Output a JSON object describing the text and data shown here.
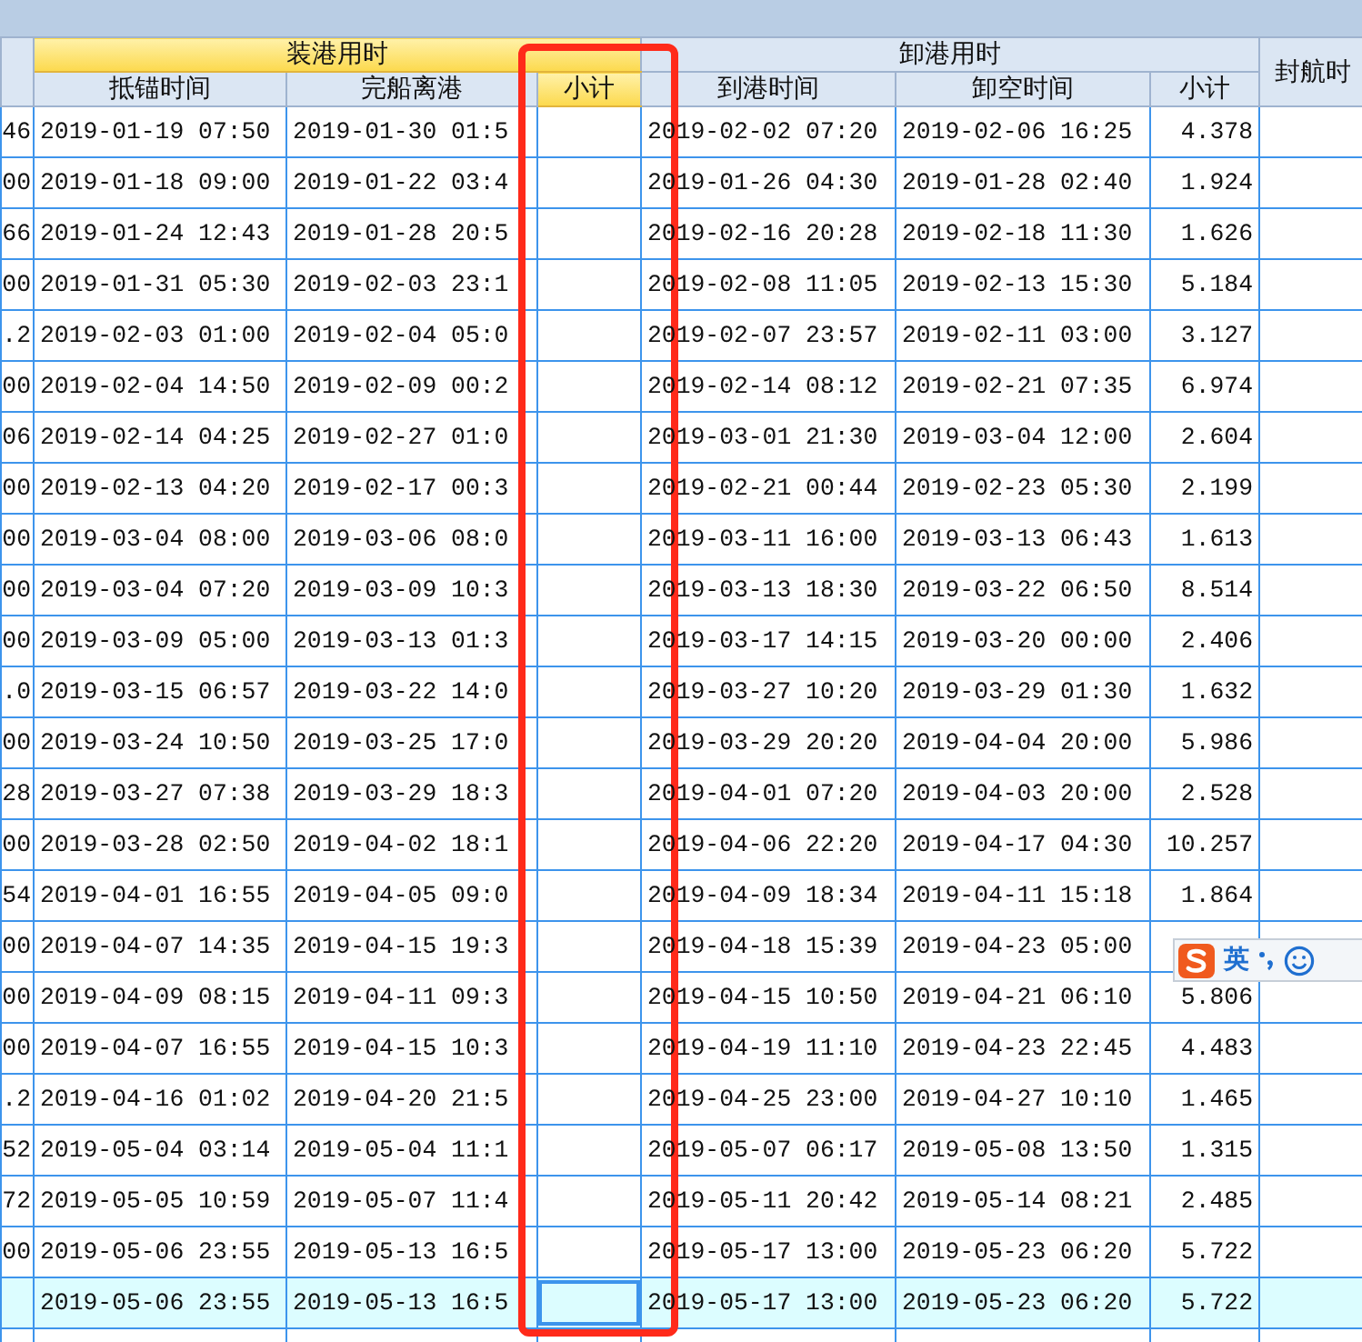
{
  "header": {
    "groups": [
      {
        "label": "装港用时",
        "selected": true
      },
      {
        "label": "卸港用时",
        "selected": false
      },
      {
        "label": "封航时",
        "selected": false
      }
    ],
    "columns": [
      {
        "label": "抵锚时间",
        "selected": false
      },
      {
        "label": "完船离港",
        "selected": false
      },
      {
        "label": "小计",
        "selected": true
      },
      {
        "label": "到港时间",
        "selected": false
      },
      {
        "label": "卸空时间",
        "selected": false
      },
      {
        "label": "小计",
        "selected": false
      }
    ]
  },
  "rows": [
    {
      "c0": "46",
      "anchor": "2019-01-19 07:50",
      "depart": "2019-01-30 01:5",
      "arrive": "2019-02-02 07:20",
      "unload": "2019-02-06 16:25",
      "subtotal": "4.378",
      "selected": false
    },
    {
      "c0": "00",
      "anchor": "2019-01-18 09:00",
      "depart": "2019-01-22 03:4",
      "arrive": "2019-01-26 04:30",
      "unload": "2019-01-28 02:40",
      "subtotal": "1.924",
      "selected": false
    },
    {
      "c0": "66",
      "anchor": "2019-01-24 12:43",
      "depart": "2019-01-28 20:5",
      "arrive": "2019-02-16 20:28",
      "unload": "2019-02-18 11:30",
      "subtotal": "1.626",
      "selected": false
    },
    {
      "c0": "00",
      "anchor": "2019-01-31 05:30",
      "depart": "2019-02-03 23:1",
      "arrive": "2019-02-08 11:05",
      "unload": "2019-02-13 15:30",
      "subtotal": "5.184",
      "selected": false
    },
    {
      "c0": ".2",
      "anchor": "2019-02-03 01:00",
      "depart": "2019-02-04 05:0",
      "arrive": "2019-02-07 23:57",
      "unload": "2019-02-11 03:00",
      "subtotal": "3.127",
      "selected": false
    },
    {
      "c0": "00",
      "anchor": "2019-02-04 14:50",
      "depart": "2019-02-09 00:2",
      "arrive": "2019-02-14 08:12",
      "unload": "2019-02-21 07:35",
      "subtotal": "6.974",
      "selected": false
    },
    {
      "c0": "06",
      "anchor": "2019-02-14 04:25",
      "depart": "2019-02-27 01:0",
      "arrive": "2019-03-01 21:30",
      "unload": "2019-03-04 12:00",
      "subtotal": "2.604",
      "selected": false
    },
    {
      "c0": "00",
      "anchor": "2019-02-13 04:20",
      "depart": "2019-02-17 00:3",
      "arrive": "2019-02-21 00:44",
      "unload": "2019-02-23 05:30",
      "subtotal": "2.199",
      "selected": false
    },
    {
      "c0": "00",
      "anchor": "2019-03-04 08:00",
      "depart": "2019-03-06 08:0",
      "arrive": "2019-03-11 16:00",
      "unload": "2019-03-13 06:43",
      "subtotal": "1.613",
      "selected": false
    },
    {
      "c0": "00",
      "anchor": "2019-03-04 07:20",
      "depart": "2019-03-09 10:3",
      "arrive": "2019-03-13 18:30",
      "unload": "2019-03-22 06:50",
      "subtotal": "8.514",
      "selected": false
    },
    {
      "c0": "00",
      "anchor": "2019-03-09 05:00",
      "depart": "2019-03-13 01:3",
      "arrive": "2019-03-17 14:15",
      "unload": "2019-03-20 00:00",
      "subtotal": "2.406",
      "selected": false
    },
    {
      "c0": ".0",
      "anchor": "2019-03-15 06:57",
      "depart": "2019-03-22 14:0",
      "arrive": "2019-03-27 10:20",
      "unload": "2019-03-29 01:30",
      "subtotal": "1.632",
      "selected": false
    },
    {
      "c0": "00",
      "anchor": "2019-03-24 10:50",
      "depart": "2019-03-25 17:0",
      "arrive": "2019-03-29 20:20",
      "unload": "2019-04-04 20:00",
      "subtotal": "5.986",
      "selected": false
    },
    {
      "c0": "28",
      "anchor": "2019-03-27 07:38",
      "depart": "2019-03-29 18:3",
      "arrive": "2019-04-01 07:20",
      "unload": "2019-04-03 20:00",
      "subtotal": "2.528",
      "selected": false
    },
    {
      "c0": "00",
      "anchor": "2019-03-28 02:50",
      "depart": "2019-04-02 18:1",
      "arrive": "2019-04-06 22:20",
      "unload": "2019-04-17 04:30",
      "subtotal": "10.257",
      "selected": false
    },
    {
      "c0": "54",
      "anchor": "2019-04-01 16:55",
      "depart": "2019-04-05 09:0",
      "arrive": "2019-04-09 18:34",
      "unload": "2019-04-11 15:18",
      "subtotal": "1.864",
      "selected": false
    },
    {
      "c0": "00",
      "anchor": "2019-04-07 14:35",
      "depart": "2019-04-15 19:3",
      "arrive": "2019-04-18 15:39",
      "unload": "2019-04-23 05:00",
      "selected": false
    },
    {
      "c0": "00",
      "anchor": "2019-04-09 08:15",
      "depart": "2019-04-11 09:3",
      "arrive": "2019-04-15 10:50",
      "unload": "2019-04-21 06:10",
      "subtotal": "5.806",
      "selected": false
    },
    {
      "c0": "00",
      "anchor": "2019-04-07 16:55",
      "depart": "2019-04-15 10:3",
      "arrive": "2019-04-19 11:10",
      "unload": "2019-04-23 22:45",
      "subtotal": "4.483",
      "selected": false
    },
    {
      "c0": ".2",
      "anchor": "2019-04-16 01:02",
      "depart": "2019-04-20 21:5",
      "arrive": "2019-04-25 23:00",
      "unload": "2019-04-27 10:10",
      "subtotal": "1.465",
      "selected": false
    },
    {
      "c0": "52",
      "anchor": "2019-05-04 03:14",
      "depart": "2019-05-04 11:1",
      "arrive": "2019-05-07 06:17",
      "unload": "2019-05-08 13:50",
      "subtotal": "1.315",
      "selected": false
    },
    {
      "c0": "72",
      "anchor": "2019-05-05 10:59",
      "depart": "2019-05-07 11:4",
      "arrive": "2019-05-11 20:42",
      "unload": "2019-05-14 08:21",
      "subtotal": "2.485",
      "selected": false
    },
    {
      "c0": "00",
      "anchor": "2019-05-06 23:55",
      "depart": "2019-05-13 16:5",
      "arrive": "2019-05-17 13:00",
      "unload": "2019-05-23 06:20",
      "subtotal": "5.722",
      "selected": false
    },
    {
      "anchor": "2019-05-06 23:55",
      "depart": "2019-05-13 16:5",
      "arrive": "2019-05-17 13:00",
      "unload": "2019-05-23 06:20",
      "subtotal": "5.722",
      "selected": true
    }
  ],
  "ime_toolbar": {
    "mode": "英"
  }
}
